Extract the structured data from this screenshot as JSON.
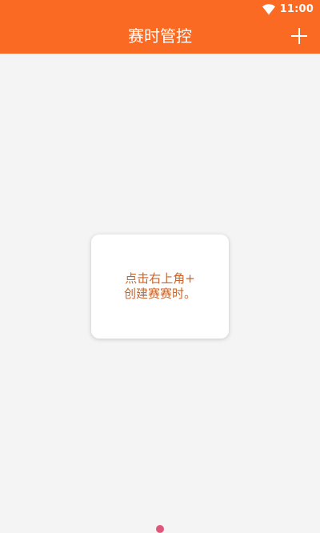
{
  "status_bar": {
    "time": "11:00",
    "wifi_icon": "wifi-icon"
  },
  "app_bar": {
    "title": "赛时管控",
    "add_icon": "plus-icon"
  },
  "empty_state": {
    "message": "点击右上角+\n创建赛赛时。"
  },
  "colors": {
    "primary": "#fa6a23",
    "background": "#f4f4f4",
    "hint_text": "#c8642a"
  }
}
